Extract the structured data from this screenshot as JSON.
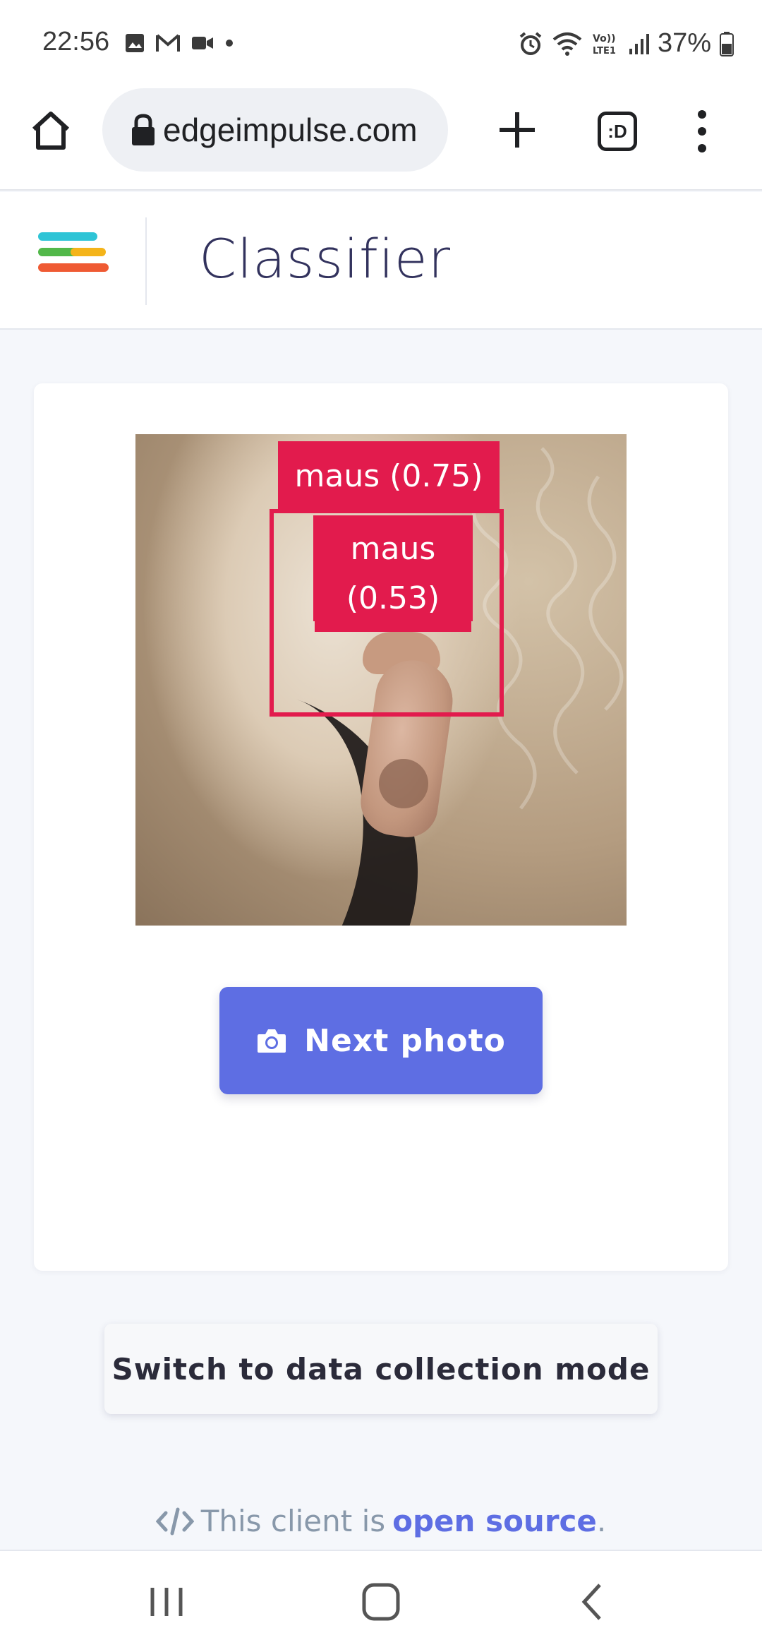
{
  "status_bar": {
    "time": "22:56",
    "battery": "37%",
    "icons": [
      "gallery-icon",
      "gmail-icon",
      "video-icon",
      "dot-icon",
      "alarm-icon",
      "wifi-icon",
      "volte-icon",
      "signal-icon",
      "battery-icon"
    ]
  },
  "browser": {
    "url": "edgeimpulse.com",
    "tab_label": ":D"
  },
  "app": {
    "title": "Classifier"
  },
  "classifier": {
    "detections": [
      {
        "label": "maus (0.75)"
      },
      {
        "label": "maus (0.53)"
      }
    ],
    "next_button": "Next photo"
  },
  "switch_button": "Switch to data collection mode",
  "footer": {
    "prefix": "This client is",
    "link": "open source",
    "suffix": "."
  },
  "colors": {
    "accent": "#5e6ee3",
    "detection": "#e21b4d"
  }
}
